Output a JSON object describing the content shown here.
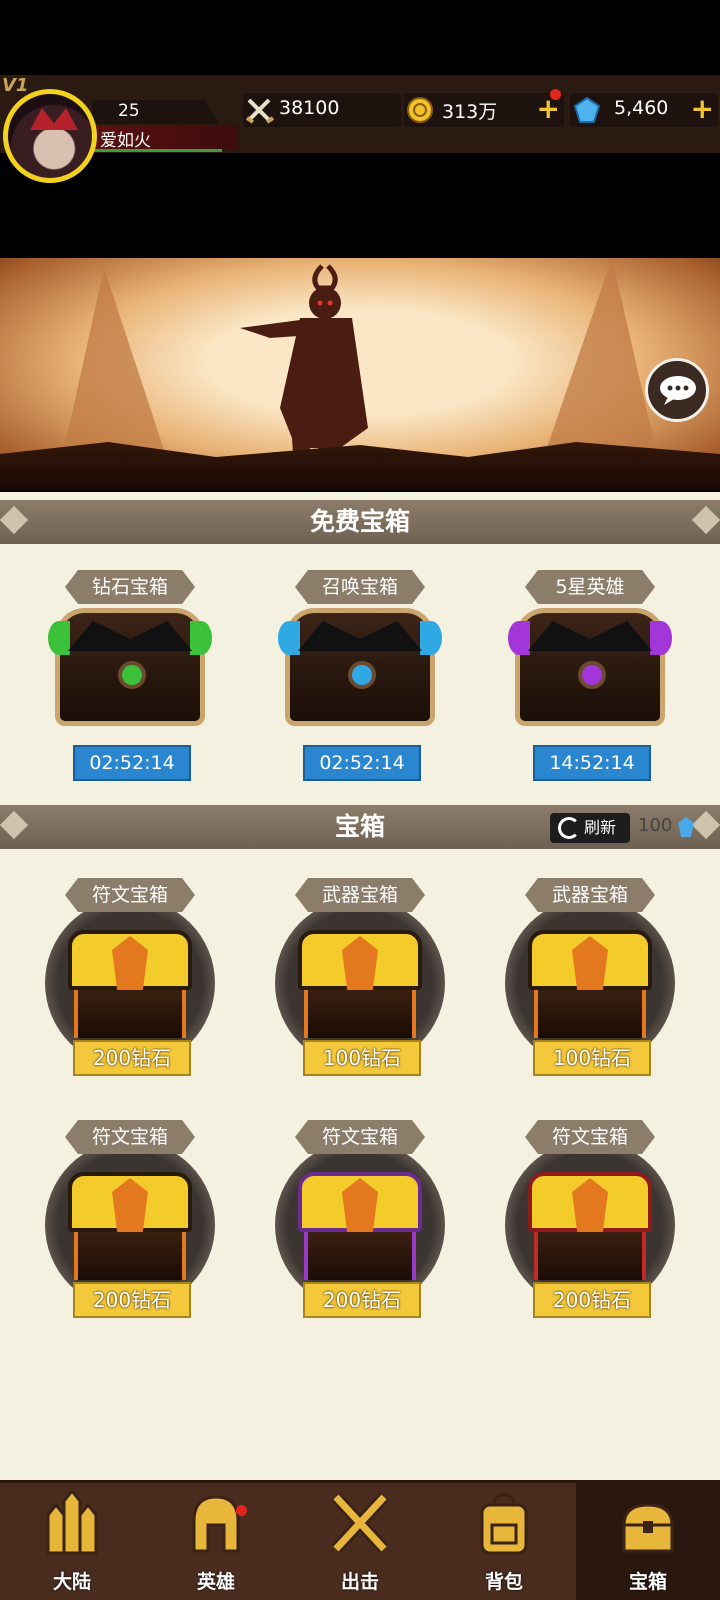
{
  "hud": {
    "vip": "V1",
    "level": "25",
    "player_name": "爱如火",
    "power": "38100",
    "gold": "313万",
    "gems": "5,460",
    "plus": "+"
  },
  "free_section": {
    "title": "免费宝箱",
    "chests": [
      {
        "label": "钻石宝箱",
        "timer": "02:52:14",
        "gem_color": "#3cc23a"
      },
      {
        "label": "召唤宝箱",
        "timer": "02:52:14",
        "gem_color": "#2fa8e4"
      },
      {
        "label": "5星英雄",
        "timer": "14:52:14",
        "gem_color": "#a236d8"
      }
    ]
  },
  "paid_section": {
    "title": "宝箱",
    "refresh_label": "刷新",
    "refresh_cost": "100",
    "chests": [
      {
        "label": "符文宝箱",
        "price": "200钻石"
      },
      {
        "label": "武器宝箱",
        "price": "100钻石"
      },
      {
        "label": "武器宝箱",
        "price": "100钻石"
      },
      {
        "label": "符文宝箱",
        "price": "200钻石"
      },
      {
        "label": "符文宝箱",
        "price": "200钻石"
      },
      {
        "label": "符文宝箱",
        "price": "200钻石"
      }
    ]
  },
  "nav": {
    "items": [
      {
        "label": "大陆",
        "icon": "castle-icon"
      },
      {
        "label": "英雄",
        "icon": "helmet-icon"
      },
      {
        "label": "出击",
        "icon": "crossed-swords-icon"
      },
      {
        "label": "背包",
        "icon": "backpack-icon"
      },
      {
        "label": "宝箱",
        "icon": "chest-icon"
      }
    ],
    "active": "宝箱"
  },
  "colors": {
    "accent_gold": "#f3c83a",
    "timer_blue": "#2a86cf",
    "section_bar": "#8c7c6a"
  }
}
